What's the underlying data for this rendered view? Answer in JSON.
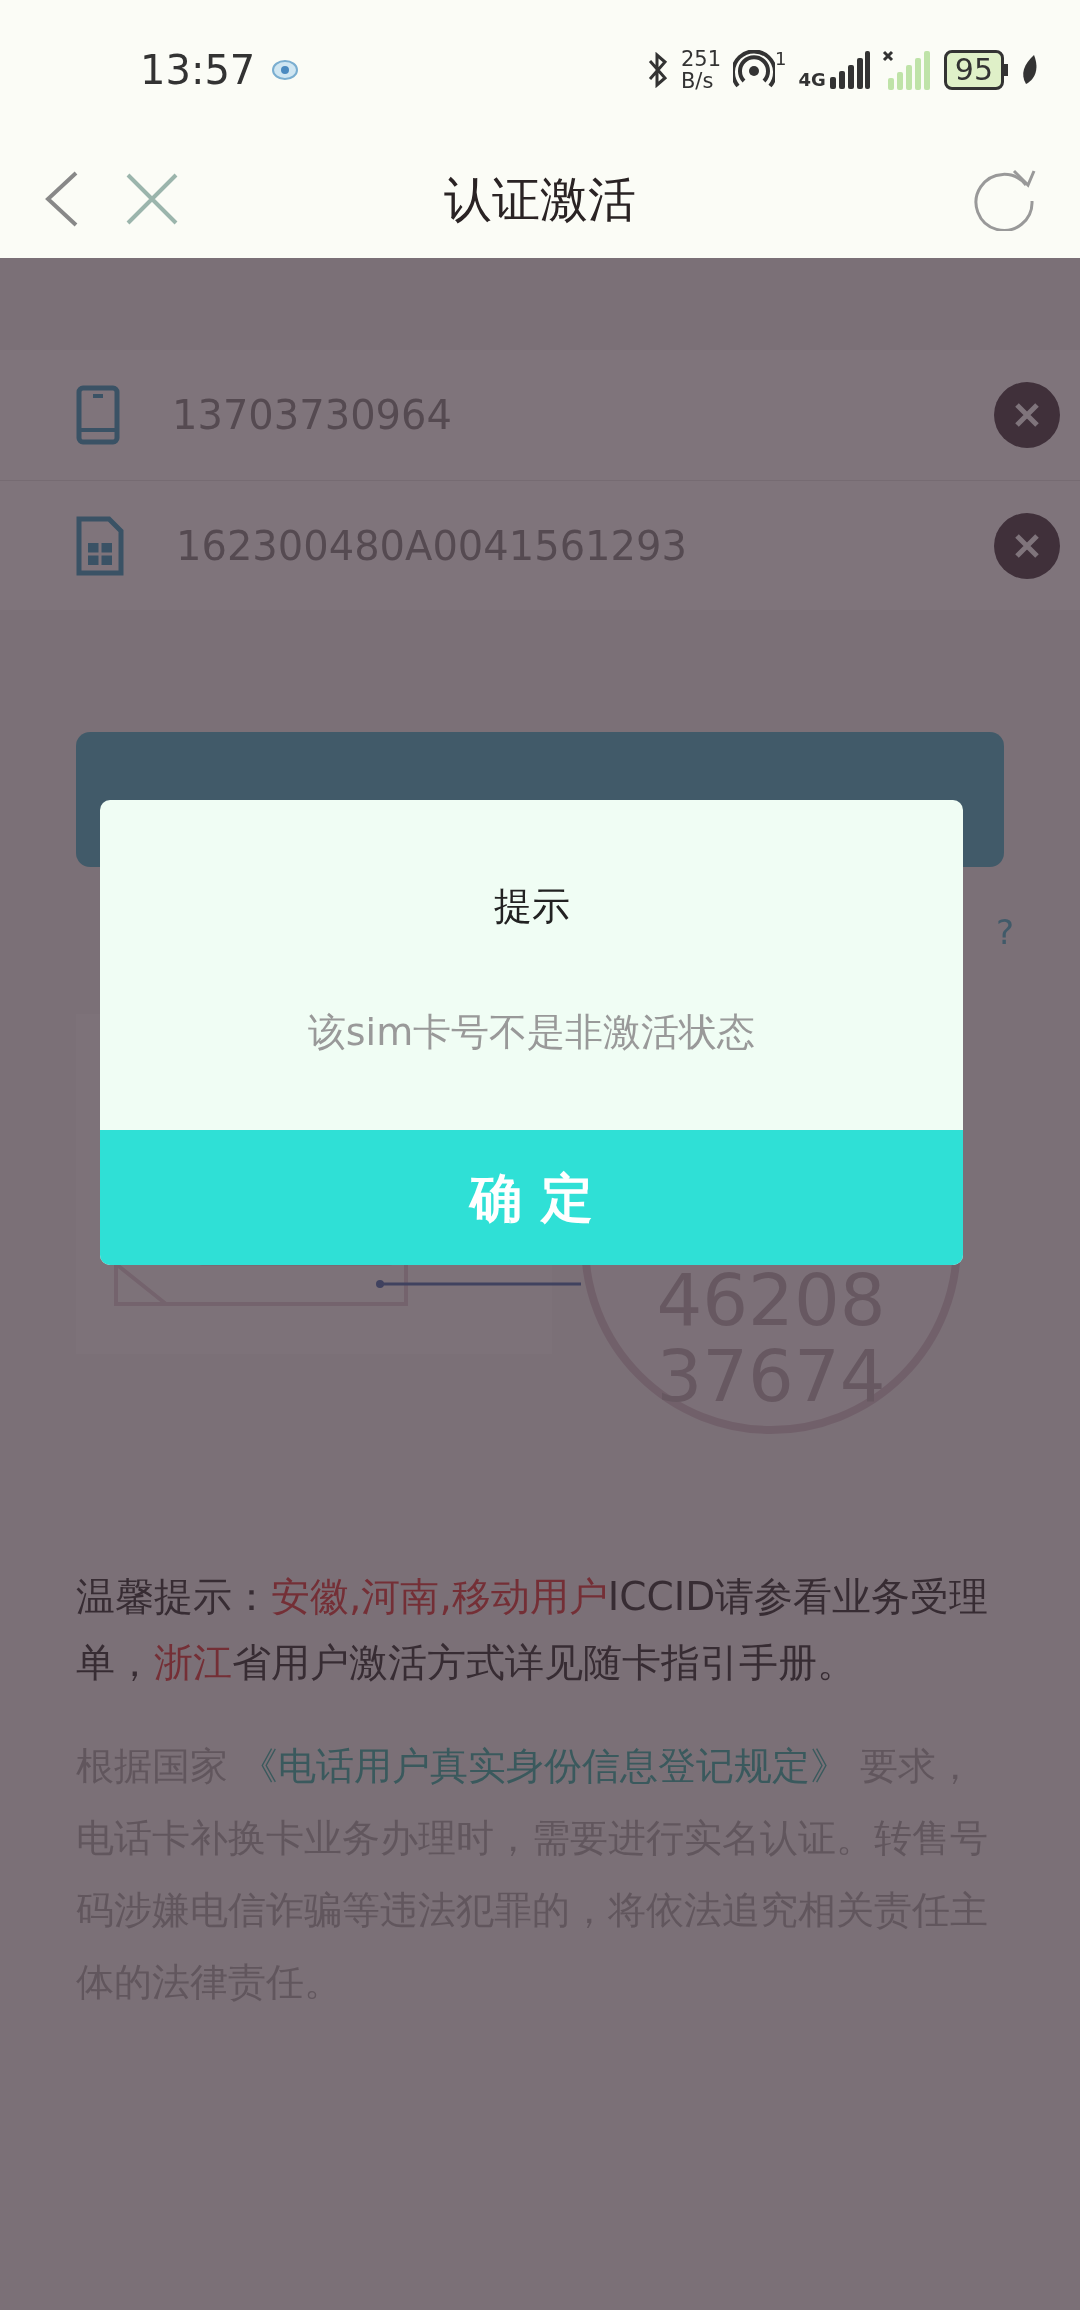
{
  "status_bar": {
    "time": "13:57",
    "net_speed": [
      "251",
      "B/s"
    ],
    "hotspot_badge": "1",
    "network": "4G",
    "battery": "95"
  },
  "header": {
    "title": "认证激活"
  },
  "fields": [
    {
      "kind": "phone",
      "value": "13703730964"
    },
    {
      "kind": "sim",
      "value": "162300480A0041561293"
    }
  ],
  "help_link": "?",
  "illustration": {
    "coin_lines": [
      "46208",
      "37674"
    ]
  },
  "notice": [
    {
      "text": "温馨提示：",
      "highlight": false
    },
    {
      "text": "安徽,河南,移动用户",
      "highlight": true
    },
    {
      "text": "ICCID请参看业务受理单，",
      "highlight": false
    },
    {
      "text": "浙江",
      "highlight": true
    },
    {
      "text": "省用户激活方式详见随卡指引手册。",
      "highlight": false
    }
  ],
  "legal": [
    {
      "text": "根据国家",
      "kind": "plain"
    },
    {
      "text": "《电话用户真实身份信息登记规定》",
      "kind": "link"
    },
    {
      "text": "要求，电话卡补换卡业务办理时，需要进行实名认证。转售号码涉嫌电信诈骗等违法犯罪的，将依法追究相关责任主体的法律责任。",
      "kind": "plain"
    }
  ],
  "dialog": {
    "title": "提示",
    "message": "该sim卡号不是非激活状态",
    "confirm": "确 定"
  }
}
